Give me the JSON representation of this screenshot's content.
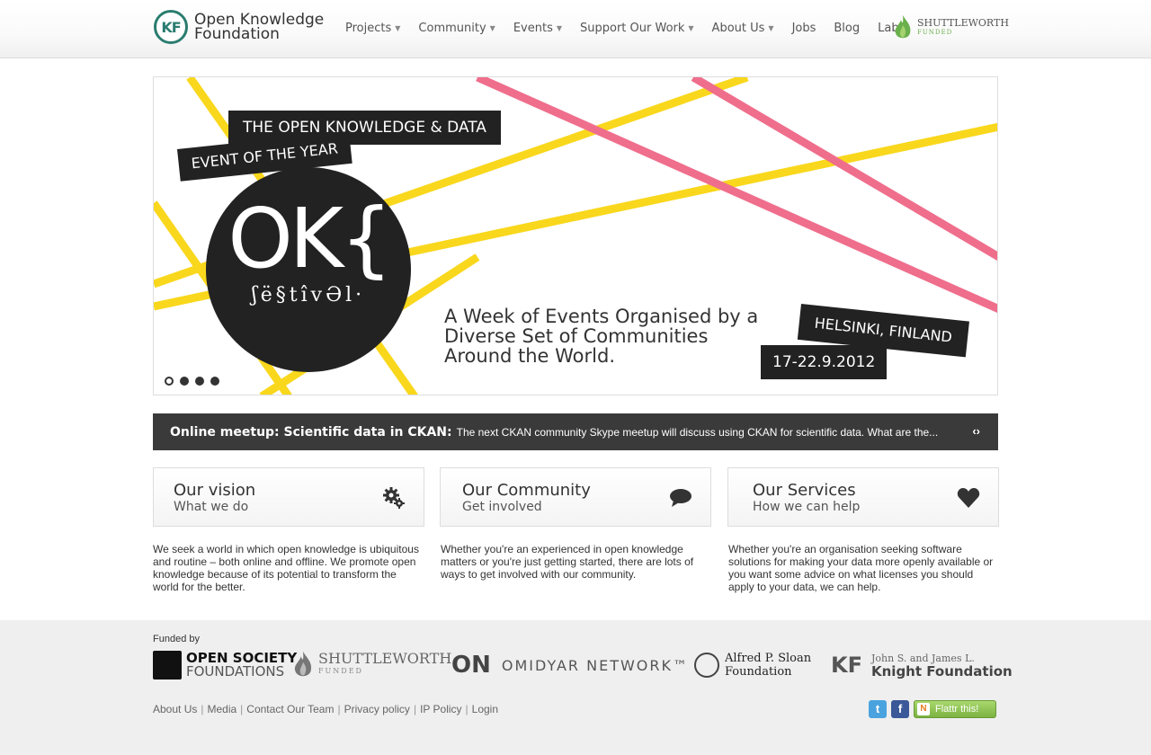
{
  "header": {
    "logo_mark": "KF",
    "logo_line1": "Open Knowledge",
    "logo_line2": "Foundation",
    "nav": [
      {
        "label": "Projects",
        "dropdown": true
      },
      {
        "label": "Community",
        "dropdown": true
      },
      {
        "label": "Events",
        "dropdown": true
      },
      {
        "label": "Support Our Work",
        "dropdown": true
      },
      {
        "label": "About Us",
        "dropdown": true
      },
      {
        "label": "Jobs",
        "dropdown": false
      },
      {
        "label": "Blog",
        "dropdown": false
      },
      {
        "label": "Labs",
        "dropdown": false
      }
    ],
    "sponsor_name": "SHUTTLEWORTH",
    "sponsor_sub": "FUNDED"
  },
  "hero": {
    "tag_top": "THE OPEN KNOWLEDGE & DATA",
    "tag_event": "EVENT OF THE YEAR",
    "logo_big": "OK{",
    "logo_sub": "ʃë§tîvƏl·",
    "description": "A Week of Events Organised by a Diverse Set of Communities Around the World.",
    "location": "HELSINKI, FINLAND",
    "dates": "17-22.9.2012",
    "slides": 4,
    "active_slide": 0
  },
  "news": {
    "title": "Online meetup: Scientific data in CKAN:",
    "text": "The next CKAN community Skype meetup will discuss using CKAN for scientific data. What are the...",
    "arrows": "‹›"
  },
  "boxes": [
    {
      "title": "Our vision",
      "subtitle": "What we do",
      "icon": "gears-icon",
      "description": "We seek a world in which open knowledge is ubiquitous and routine – both online and offline. We promote open knowledge because of its potential to transform the world for the better."
    },
    {
      "title": "Our Community",
      "subtitle": "Get involved",
      "icon": "speech-bubble-icon",
      "description": "Whether you're an experienced in open knowledge matters or you're just getting started, there are lots of ways to get involved with our community."
    },
    {
      "title": "Our Services",
      "subtitle": "How we can help",
      "icon": "heart-icon",
      "description": "Whether you're an organisation seeking software solutions for making your data more openly available or you want some advice on what licenses you should apply to your data, we can help."
    }
  ],
  "footer": {
    "funded_label": "Funded by",
    "funders": {
      "osf_line1": "OPEN SOCIETY",
      "osf_line2": "FOUNDATIONS",
      "shuttleworth": "SHUTTLEWORTH",
      "shuttleworth_sub": "FUNDED",
      "omidyar_mark": "ON",
      "omidyar": "OMIDYAR NETWORK™",
      "sloan_line1": "Alfred P. Sloan",
      "sloan_line2": "Foundation",
      "knight_mark": "KF",
      "knight_line1": "John S. and James L.",
      "knight_line2": "Knight Foundation"
    },
    "links": [
      "About Us",
      "Media",
      "Contact Our Team",
      "Privacy policy",
      "IP Policy",
      "Login"
    ],
    "separator": "|",
    "twitter": "t",
    "facebook": "f",
    "flattr_label": "Flattr this!",
    "flattr_icon": "N"
  },
  "colors": {
    "yellow_line": "#f9d71c",
    "pink_line": "#ef6e8c",
    "logo_teal": "#2a7c6f",
    "dark_tag": "#222222"
  }
}
